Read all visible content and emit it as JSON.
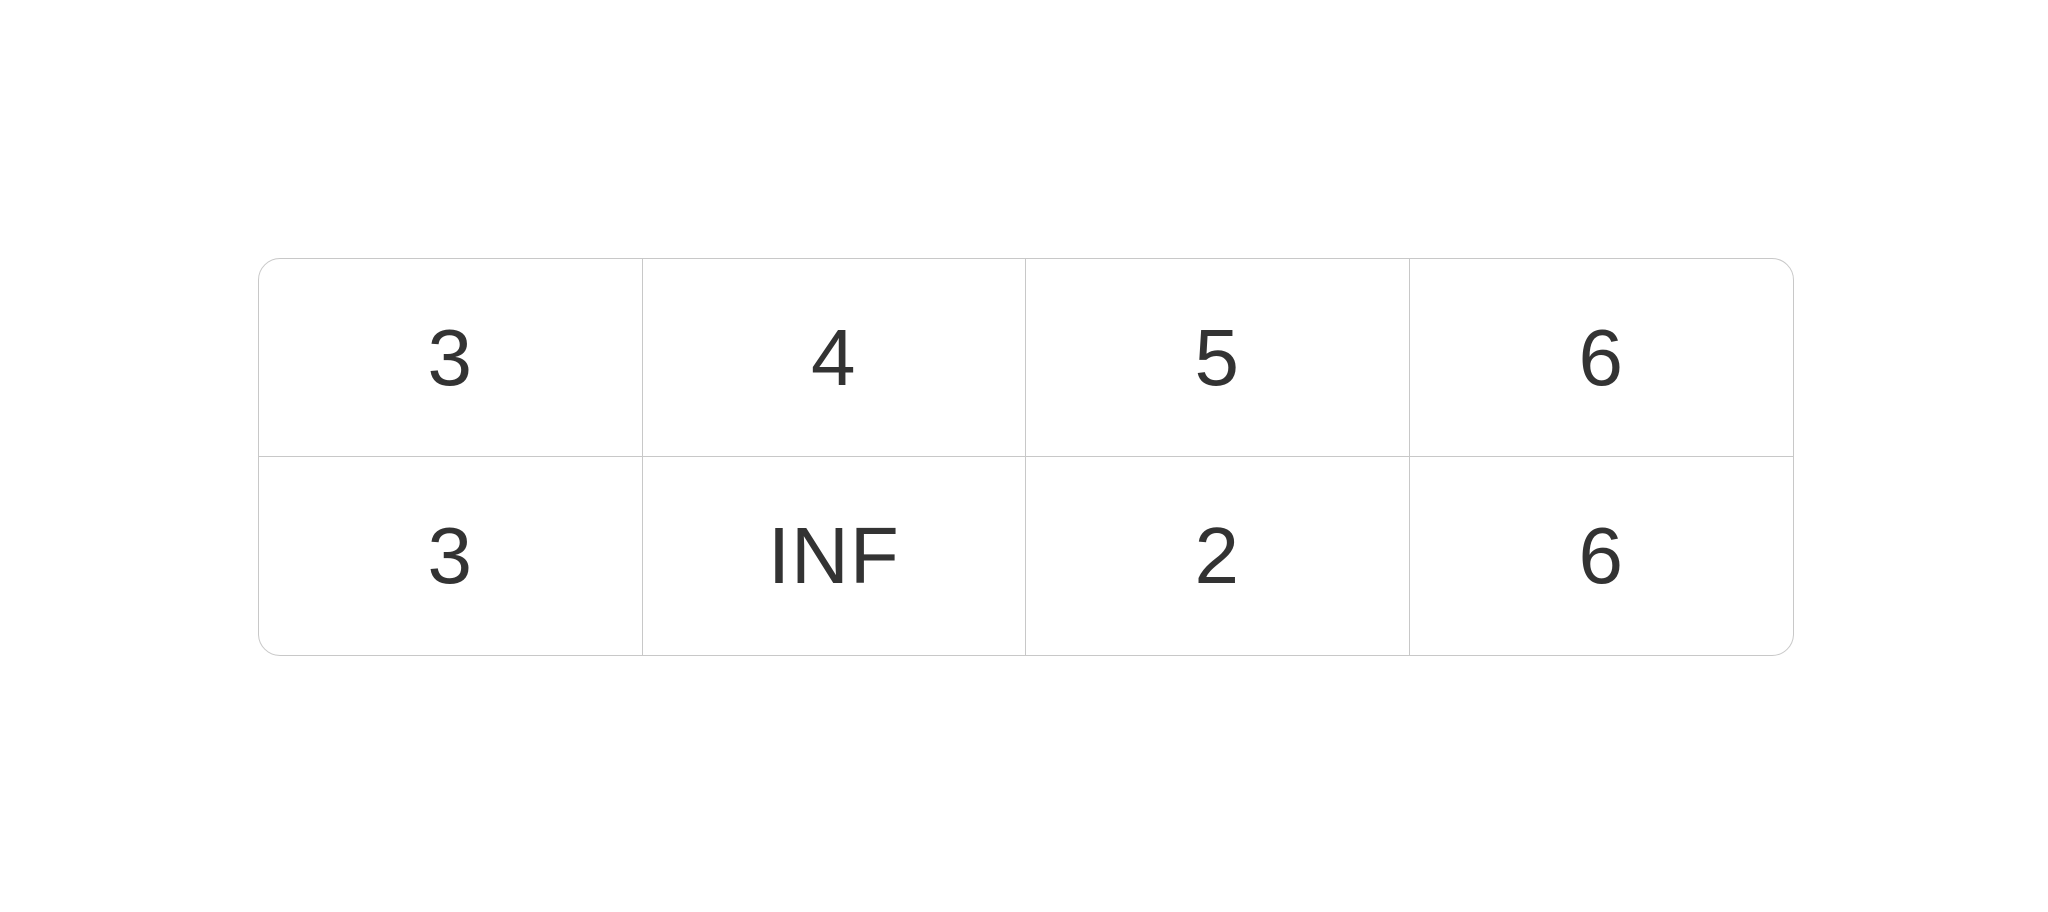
{
  "rows": [
    [
      "3",
      "4",
      "5",
      "6"
    ],
    [
      "3",
      "INF",
      "2",
      "6"
    ]
  ]
}
